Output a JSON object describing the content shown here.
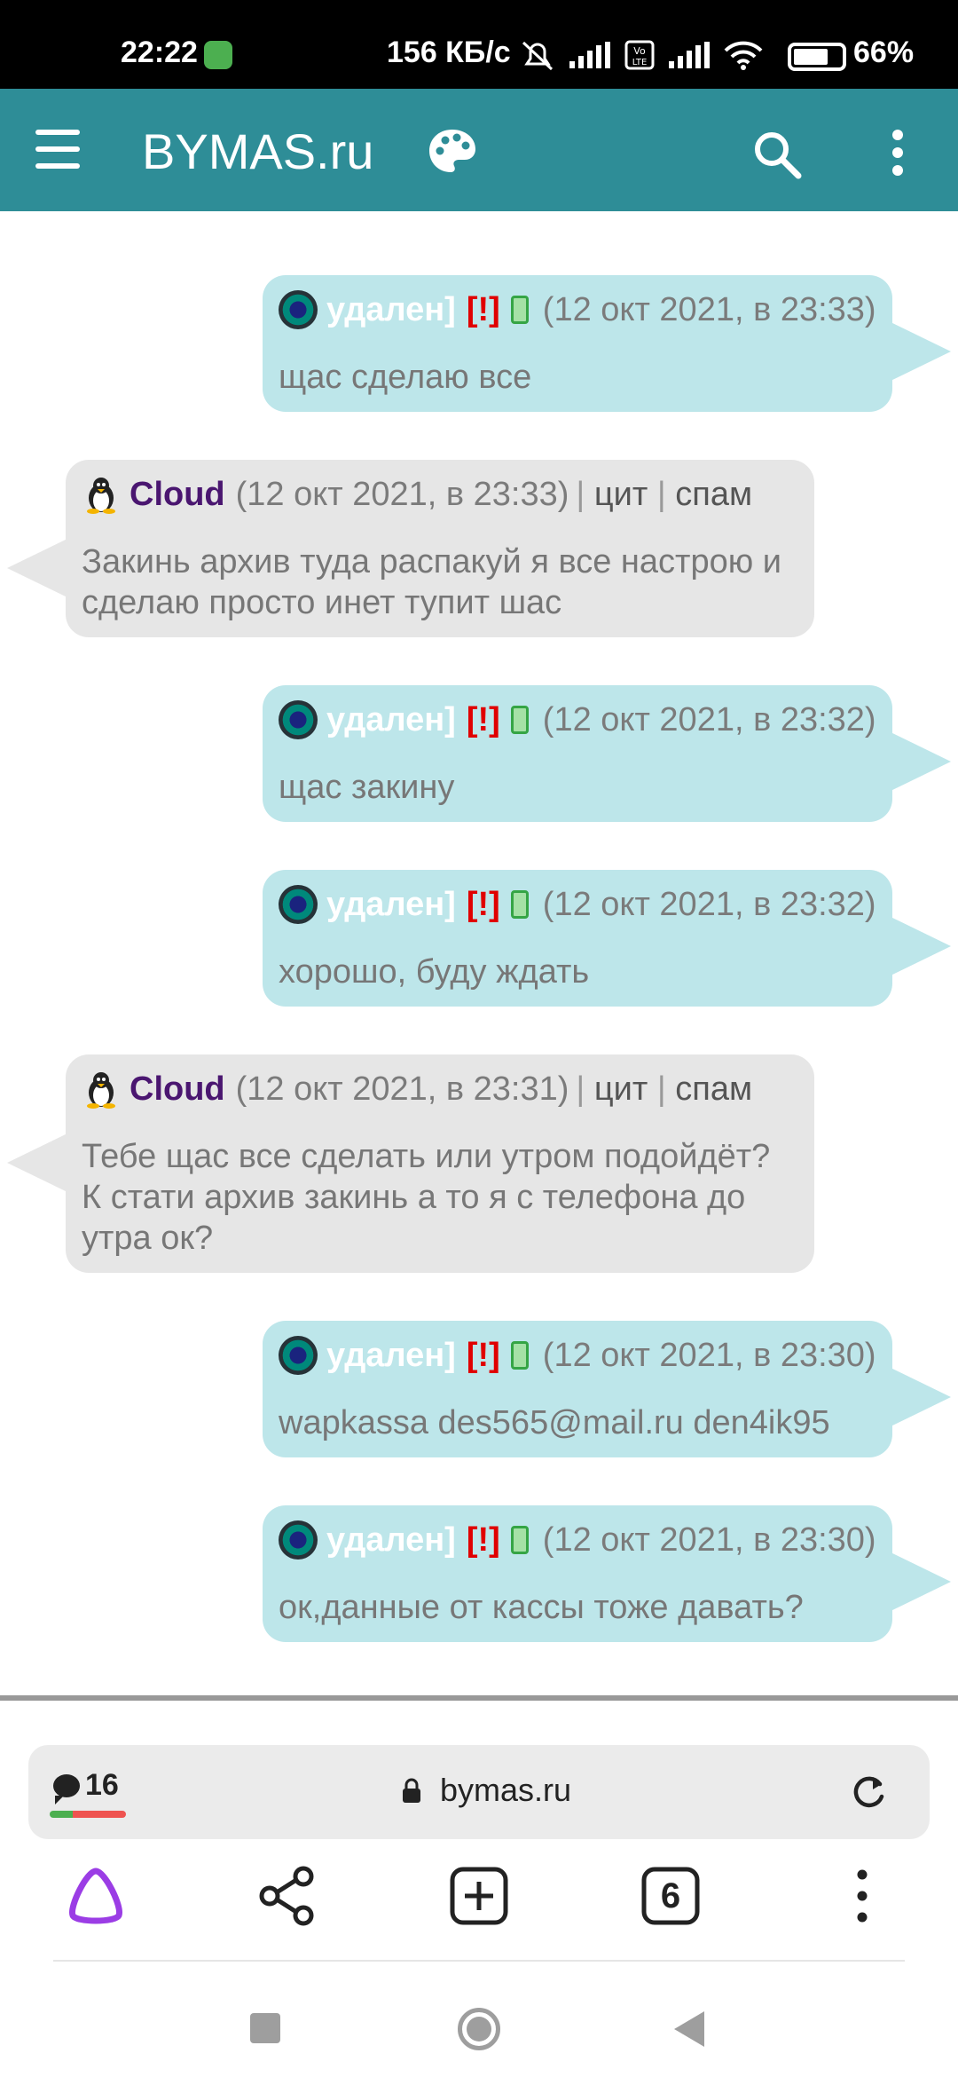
{
  "status_bar": {
    "time": "22:22",
    "speed": "156 КБ/с",
    "battery": "66%",
    "battery_level": 0.66
  },
  "app_bar": {
    "title": "BYMAS.ru"
  },
  "messages": [
    {
      "side": "mine",
      "user": "удален]",
      "alert": "[!]",
      "timestamp": "(12 окт 2021, в 23:33)",
      "text": "щас сделаю все"
    },
    {
      "side": "theirs",
      "user": "Cloud",
      "timestamp": "(12 окт 2021, в 23:33)",
      "quote": "цит",
      "sep": "|",
      "spam": "спам",
      "text": "Закинь архив туда распакуй я все настрою и сделаю просто инет тупит шас"
    },
    {
      "side": "mine",
      "user": "удален]",
      "alert": "[!]",
      "timestamp": "(12 окт 2021, в 23:32)",
      "text": "щас закину"
    },
    {
      "side": "mine",
      "user": "удален]",
      "alert": "[!]",
      "timestamp": "(12 окт 2021, в 23:32)",
      "text": "хорошо, буду ждать"
    },
    {
      "side": "theirs",
      "user": "Cloud",
      "timestamp": "(12 окт 2021, в 23:31)",
      "quote": "цит",
      "sep": "|",
      "spam": "спам",
      "text": "Тебе щас все сделать или утром подойдёт? К стати архив закинь а то я с телефона до утра ок?"
    },
    {
      "side": "mine",
      "user": "удален]",
      "alert": "[!]",
      "timestamp": "(12 окт 2021, в 23:30)",
      "text": "wapkassa des565@mail.ru den4ik95"
    },
    {
      "side": "mine",
      "user": "удален]",
      "alert": "[!]",
      "timestamp": "(12 окт 2021, в 23:30)",
      "text": "ок,данные от кассы тоже давать?"
    }
  ],
  "browser": {
    "comments_count": "16",
    "domain": "bymas.ru",
    "tabs_count": "6"
  }
}
